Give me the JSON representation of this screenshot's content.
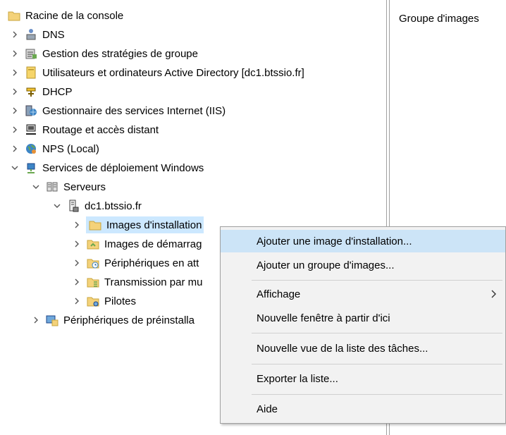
{
  "tree": [
    {
      "label": "Racine de la console",
      "icon": "folder-icon",
      "expander": "none"
    },
    {
      "label": "DNS",
      "icon": "dns-icon",
      "expander": "collapsed"
    },
    {
      "label": "Gestion des stratégies de groupe",
      "icon": "group-policy-icon",
      "expander": "collapsed"
    },
    {
      "label": "Utilisateurs et ordinateurs Active Directory [dc1.btssio.fr]",
      "icon": "active-directory-icon",
      "expander": "collapsed"
    },
    {
      "label": "DHCP",
      "icon": "dhcp-icon",
      "expander": "collapsed"
    },
    {
      "label": "Gestionnaire des services Internet (IIS)",
      "icon": "iis-icon",
      "expander": "collapsed"
    },
    {
      "label": "Routage et accès distant",
      "icon": "routing-icon",
      "expander": "collapsed"
    },
    {
      "label": "NPS (Local)",
      "icon": "nps-icon",
      "expander": "collapsed"
    },
    {
      "label": "Services de déploiement Windows",
      "icon": "wds-icon",
      "expander": "expanded"
    },
    {
      "label": "Serveurs",
      "icon": "servers-icon",
      "expander": "expanded"
    },
    {
      "label": "dc1.btssio.fr",
      "icon": "server-icon",
      "expander": "expanded"
    },
    {
      "label": "Images d'installation",
      "icon": "folder-icon",
      "expander": "collapsed",
      "selected": true
    },
    {
      "label": "Images de démarrag",
      "icon": "boot-images-icon",
      "expander": "collapsed"
    },
    {
      "label": "Périphériques en att",
      "icon": "pending-devices-icon",
      "expander": "collapsed"
    },
    {
      "label": "Transmission par mu",
      "icon": "multicast-icon",
      "expander": "collapsed"
    },
    {
      "label": "Pilotes",
      "icon": "drivers-icon",
      "expander": "collapsed"
    },
    {
      "label": "Périphériques de préinstalla",
      "icon": "prestaged-devices-icon",
      "expander": "collapsed"
    }
  ],
  "actions_pane": {
    "title": "Groupe d'images"
  },
  "context_menu": {
    "items": [
      {
        "label": "Ajouter une image d'installation...",
        "highlighted": true
      },
      {
        "label": "Ajouter un groupe d'images..."
      },
      {
        "label": "Affichage",
        "submenu": true
      },
      {
        "label": "Nouvelle fenêtre à partir d'ici"
      },
      {
        "label": "Nouvelle vue de la liste des tâches..."
      },
      {
        "label": "Exporter la liste..."
      },
      {
        "label": "Aide"
      }
    ]
  }
}
